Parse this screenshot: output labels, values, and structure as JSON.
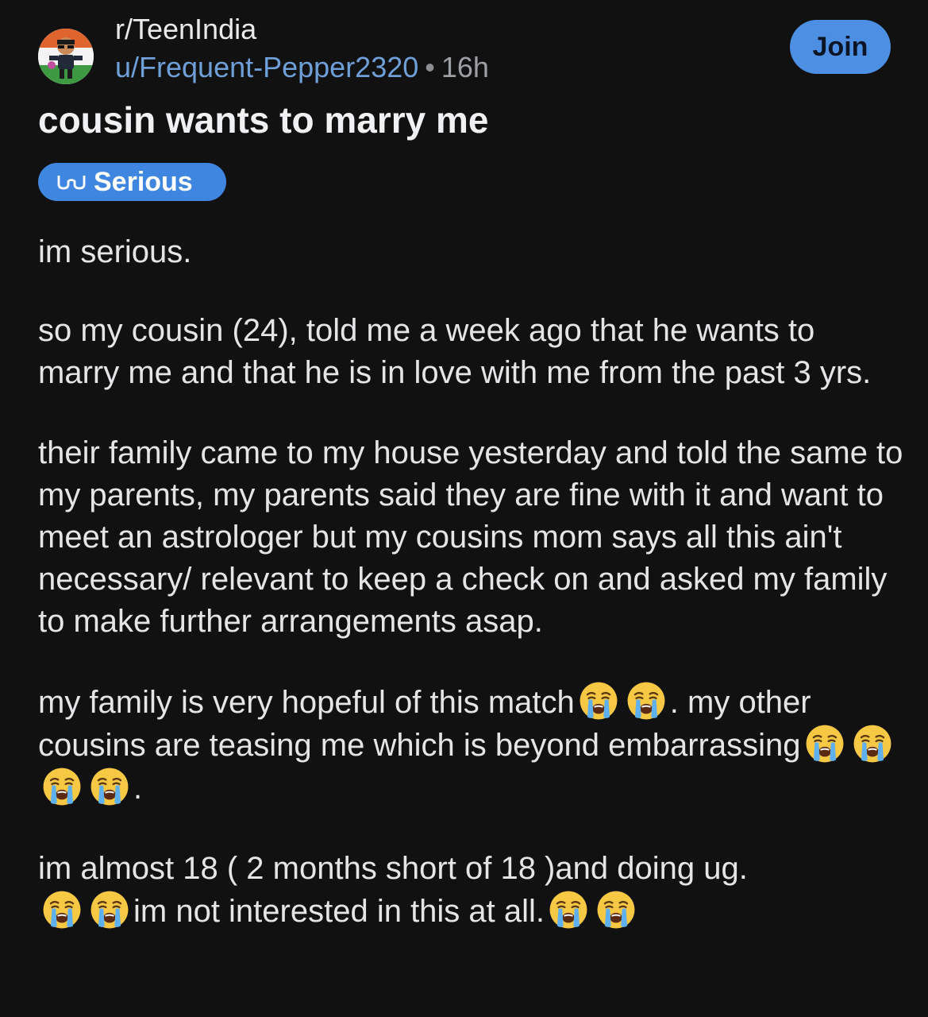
{
  "post": {
    "subreddit": "r/TeenIndia",
    "author": "u/Frequent-Pepper2320",
    "separator": "•",
    "age": "16h",
    "join_label": "Join",
    "title": "cousin wants to marry me",
    "flair": {
      "label": "Serious",
      "icon": "glasses-icon"
    },
    "body": {
      "p1": "im serious.",
      "p2": "so my cousin (24), told me a week ago that he wants to marry me and that he is in love with me from the past 3 yrs.",
      "p3": "their family came to my house yesterday and told the same to my parents, my parents said they are fine with it and want to meet an astrologer but my cousins mom says all this ain't necessary/ relevant to keep a check on and asked my family to make further arrangements asap.",
      "p4a": "my family is very hopeful of this match",
      "p4b": ". my other cousins are teasing me which is beyond embarrassing",
      "p4c": ".",
      "p5a": "im almost 18 ( 2 months short of 18 )and doing ug.",
      "p5b": "im not interested in this at all."
    },
    "emoji_icon": "loudly-crying-face-icon"
  },
  "colors": {
    "background": "#111112",
    "author_link": "#6f9fd8",
    "join_button": "#4d90e3",
    "flair": "#3f86e0"
  }
}
